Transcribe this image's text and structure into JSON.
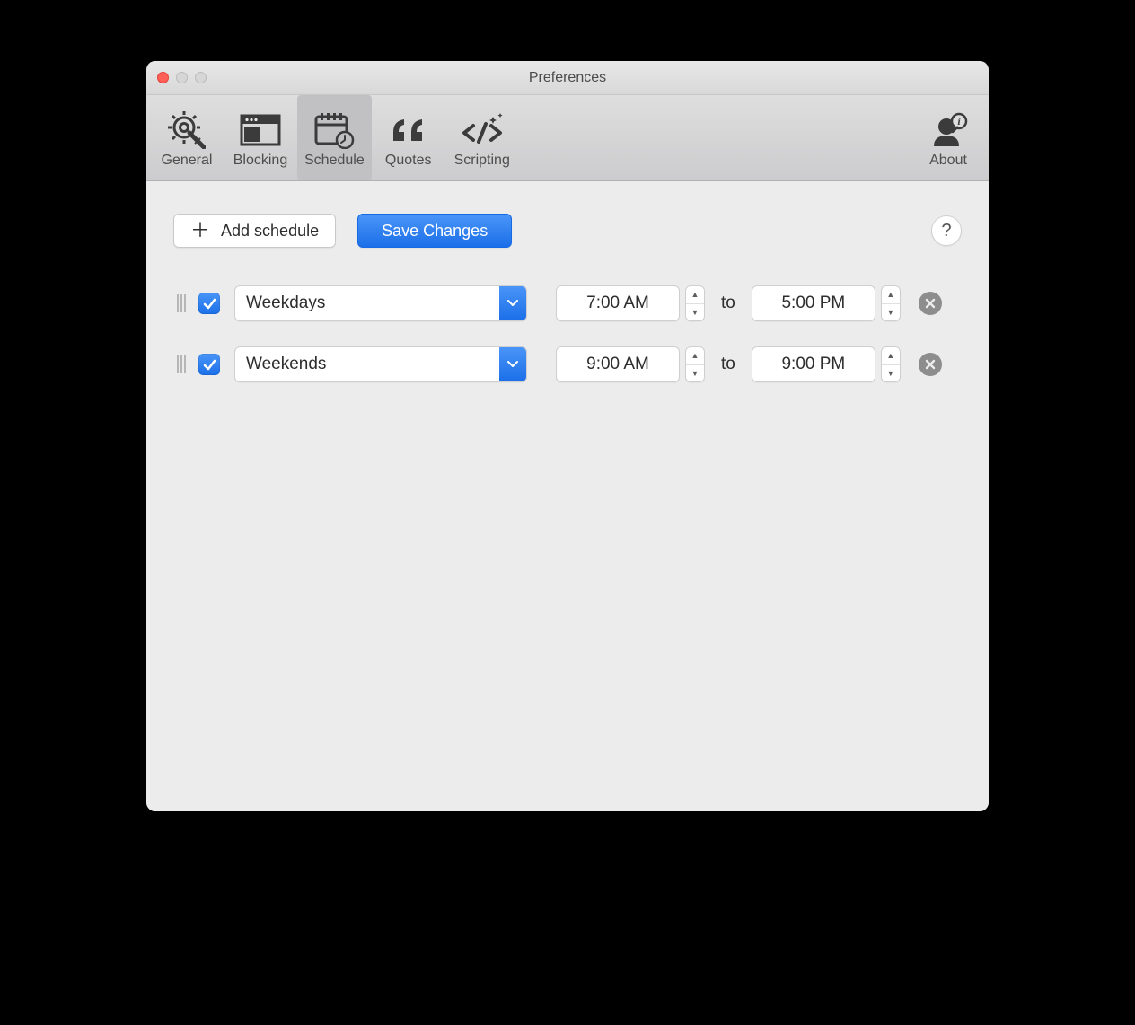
{
  "window": {
    "title": "Preferences"
  },
  "toolbar": {
    "items": [
      {
        "id": "general",
        "label": "General"
      },
      {
        "id": "blocking",
        "label": "Blocking"
      },
      {
        "id": "schedule",
        "label": "Schedule"
      },
      {
        "id": "quotes",
        "label": "Quotes"
      },
      {
        "id": "scripting",
        "label": "Scripting"
      }
    ],
    "about_label": "About",
    "active": "schedule"
  },
  "actions": {
    "add_schedule_label": "Add schedule",
    "save_changes_label": "Save Changes",
    "help_label": "?"
  },
  "schedule": {
    "to_label": "to",
    "rows": [
      {
        "enabled": true,
        "period": "Weekdays",
        "start": "7:00 AM",
        "end": "5:00 PM"
      },
      {
        "enabled": true,
        "period": "Weekends",
        "start": "9:00 AM",
        "end": "9:00 PM"
      }
    ]
  }
}
